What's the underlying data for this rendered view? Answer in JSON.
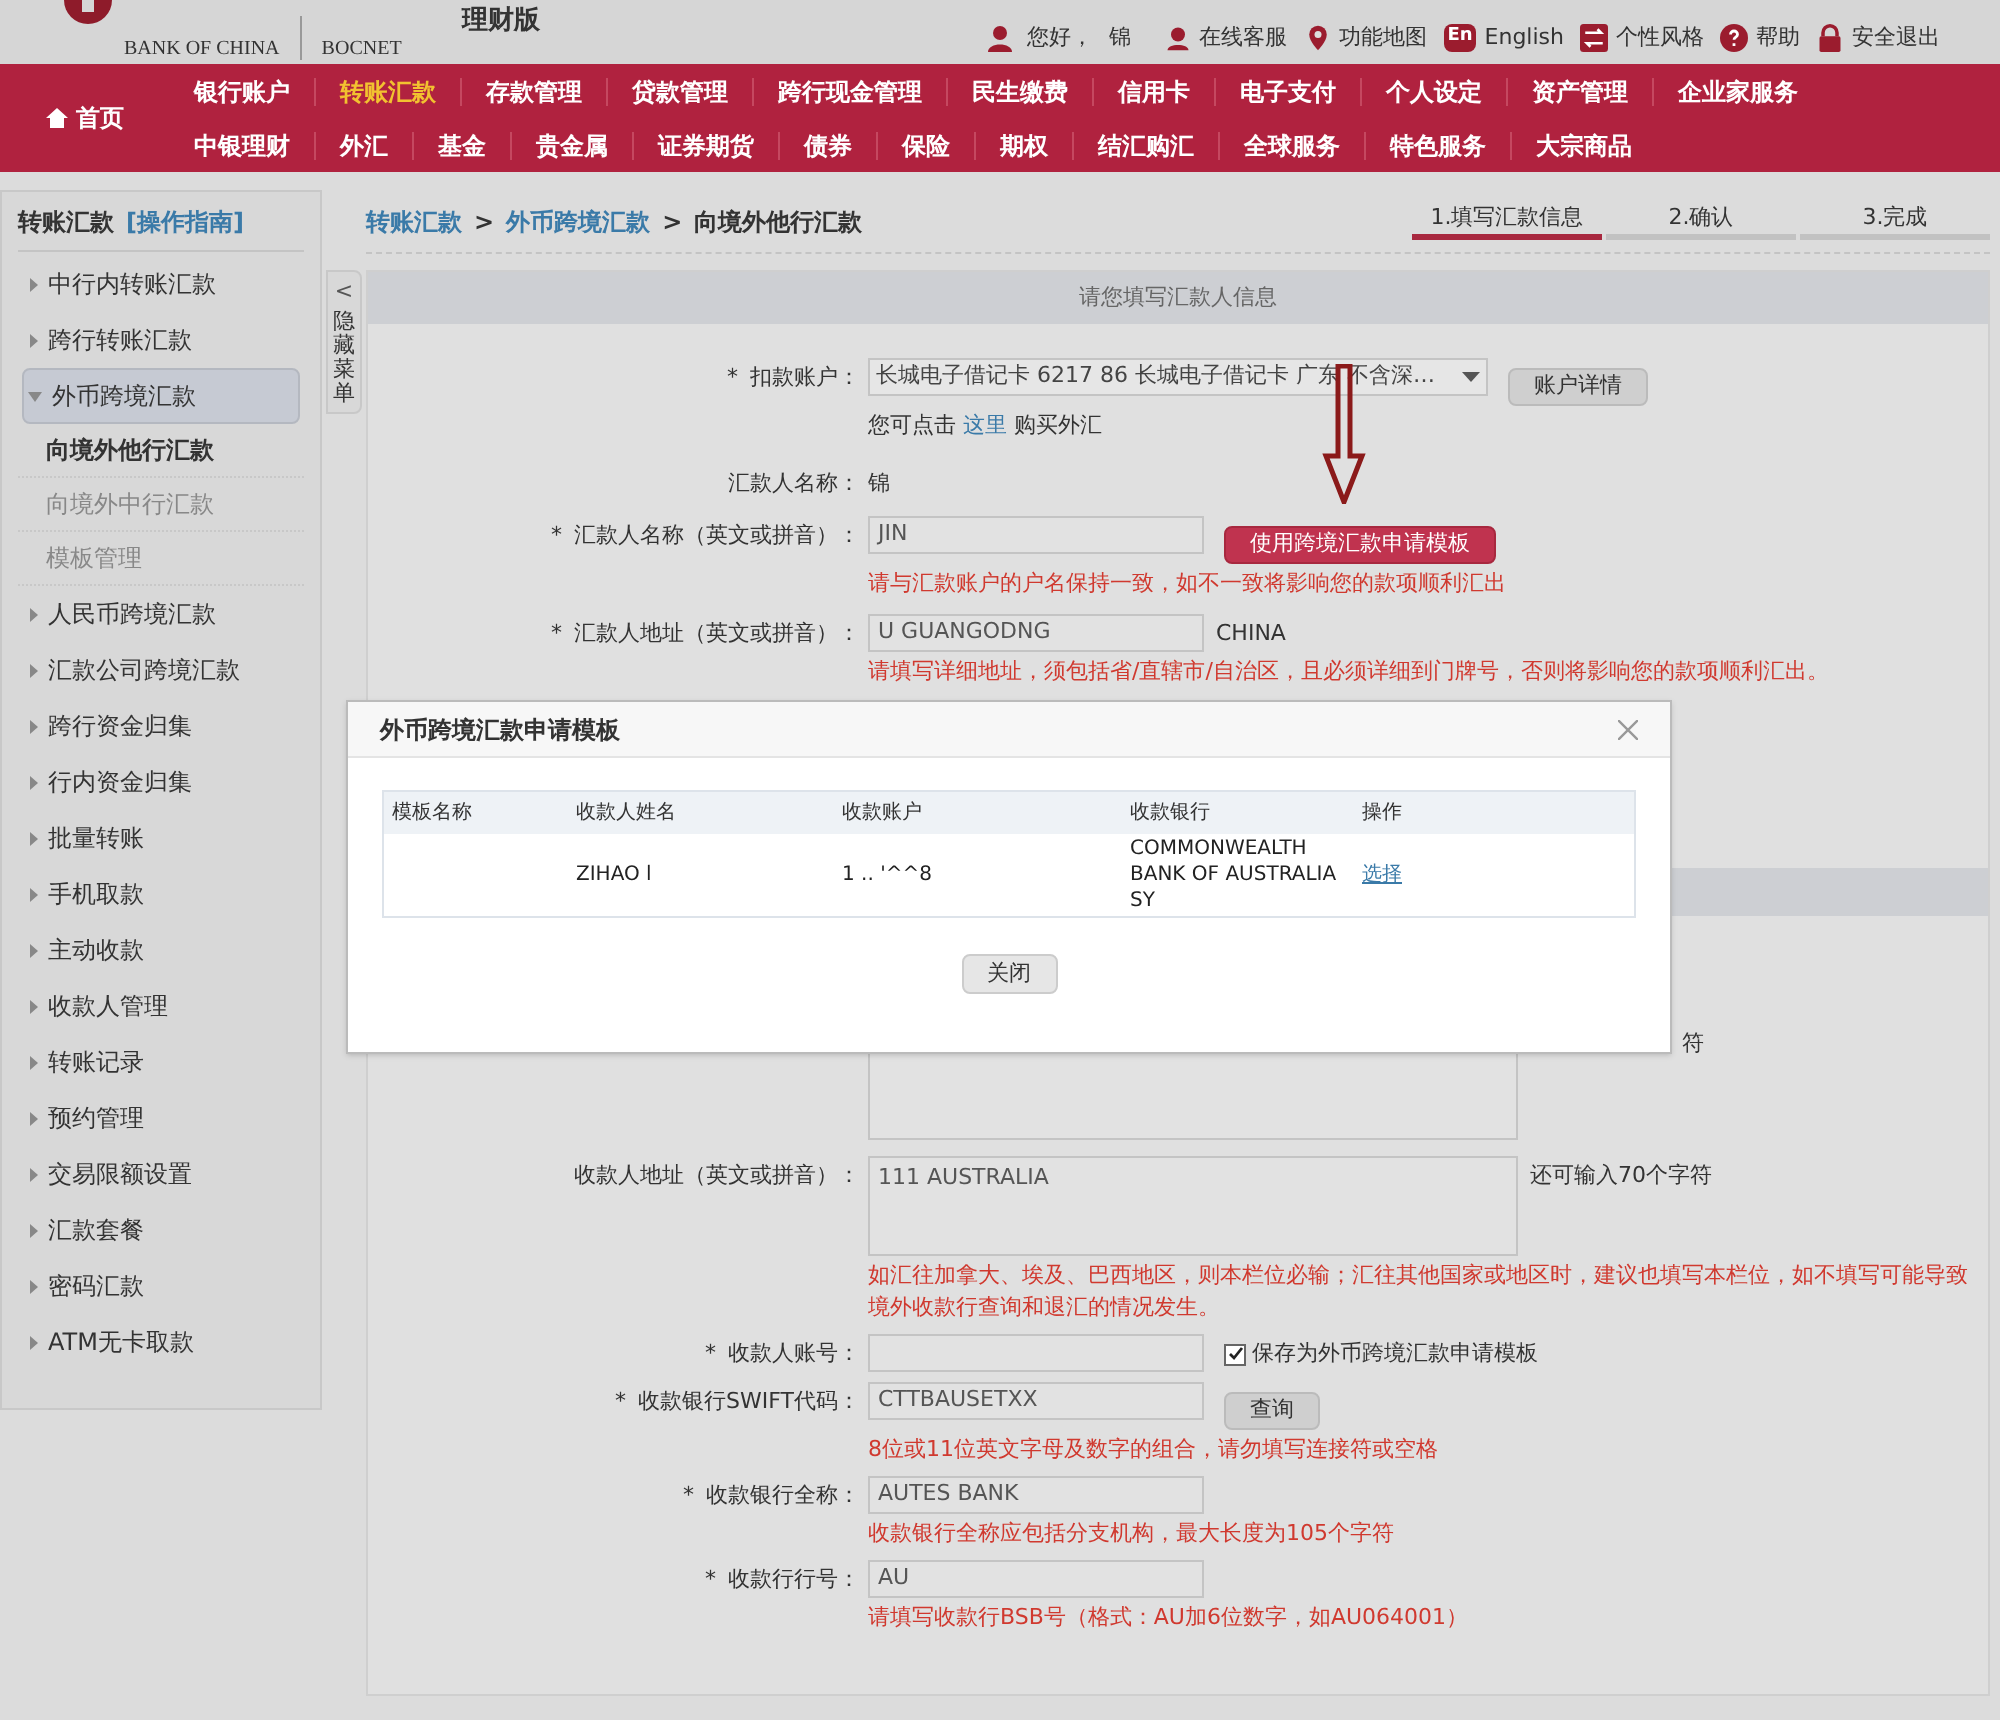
{
  "header": {
    "logo_text": "BANK OF CHINA",
    "brand": "BOCNET",
    "edition": "理财版",
    "greeting": "您好，",
    "user": "锦",
    "links": [
      {
        "kind": "service",
        "label": "在线客服"
      },
      {
        "kind": "map",
        "label": "功能地图"
      },
      {
        "kind": "language",
        "badge": "En",
        "label": "English"
      },
      {
        "kind": "style",
        "label": "个性风格"
      },
      {
        "kind": "help",
        "label": "帮助"
      },
      {
        "kind": "logout",
        "label": "安全退出"
      }
    ]
  },
  "nav": {
    "home": "首页",
    "primary": [
      {
        "label": "银行账户",
        "selected": false
      },
      {
        "label": "转账汇款",
        "selected": true
      },
      {
        "label": "存款管理",
        "selected": false
      },
      {
        "label": "贷款管理",
        "selected": false
      },
      {
        "label": "跨行现金管理",
        "selected": false
      },
      {
        "label": "民生缴费",
        "selected": false
      },
      {
        "label": "信用卡",
        "selected": false
      },
      {
        "label": "电子支付",
        "selected": false
      },
      {
        "label": "个人设定",
        "selected": false
      },
      {
        "label": "资产管理",
        "selected": false
      },
      {
        "label": "企业家服务",
        "selected": false
      }
    ],
    "secondary": [
      {
        "label": "中银理财",
        "selected": false
      },
      {
        "label": "外汇",
        "selected": false
      },
      {
        "label": "基金",
        "selected": false
      },
      {
        "label": "贵金属",
        "selected": false
      },
      {
        "label": "证券期货",
        "selected": false
      },
      {
        "label": "债券",
        "selected": false
      },
      {
        "label": "保险",
        "selected": false
      },
      {
        "label": "期权",
        "selected": false
      },
      {
        "label": "结汇购汇",
        "selected": false
      },
      {
        "label": "全球服务",
        "selected": false
      },
      {
        "label": "特色服务",
        "selected": false
      },
      {
        "label": "大宗商品",
        "selected": false
      }
    ]
  },
  "sidebar": {
    "title": "转账汇款",
    "guide": "[操作指南]",
    "collapse_arrow": "<",
    "collapse_label": "隐藏菜单",
    "items": [
      {
        "label": "中行内转账汇款",
        "expanded": false
      },
      {
        "label": "跨行转账汇款",
        "expanded": false
      },
      {
        "label": "外币跨境汇款",
        "expanded": true,
        "children": [
          {
            "label": "向境外他行汇款",
            "selected": true
          },
          {
            "label": "向境外中行汇款",
            "selected": false
          },
          {
            "label": "模板管理",
            "selected": false
          }
        ]
      },
      {
        "label": "人民币跨境汇款",
        "expanded": false
      },
      {
        "label": "汇款公司跨境汇款",
        "expanded": false
      },
      {
        "label": "跨行资金归集",
        "expanded": false
      },
      {
        "label": "行内资金归集",
        "expanded": false
      },
      {
        "label": "批量转账",
        "expanded": false
      },
      {
        "label": "手机取款",
        "expanded": false
      },
      {
        "label": "主动收款",
        "expanded": false
      },
      {
        "label": "收款人管理",
        "expanded": false
      },
      {
        "label": "转账记录",
        "expanded": false
      },
      {
        "label": "预约管理",
        "expanded": false
      },
      {
        "label": "交易限额设置",
        "expanded": false
      },
      {
        "label": "汇款套餐",
        "expanded": false
      },
      {
        "label": "密码汇款",
        "expanded": false
      },
      {
        "label": "ATM无卡取款",
        "expanded": false
      }
    ]
  },
  "breadcrumb": {
    "separator": ">",
    "items": [
      {
        "label": "转账汇款",
        "kind": "link"
      },
      {
        "label": "外币跨境汇款",
        "kind": "link"
      },
      {
        "label": "向境外他行汇款",
        "kind": "current"
      }
    ]
  },
  "steps": [
    {
      "label": "1.填写汇款信息",
      "selected": true
    },
    {
      "label": "2.确认",
      "selected": false
    },
    {
      "label": "3.完成",
      "selected": false
    }
  ],
  "section_title": "请您填写汇款人信息",
  "top_rows": [
    {
      "kind": "select",
      "required_mark": "*",
      "label": "扣款账户：",
      "value": "长城电子借记卡 6217 86 长城电子借记卡 广东 不含深…",
      "button": {
        "label": "账户详情",
        "kind": "plain"
      }
    },
    {
      "kind": "note",
      "before": "您可点击",
      "link": "这里",
      "after": "购买外汇"
    },
    {
      "kind": "static",
      "label": "汇款人名称：",
      "value": "锦"
    },
    {
      "kind": "input",
      "required_mark": "*",
      "label": "汇款人名称（英文或拼音）：",
      "value": "JIN",
      "button": {
        "label": "使用跨境汇款申请模板",
        "kind": "primary"
      },
      "hint": "请与汇款账户的户名保持一致，如不一致将影响您的款项顺利汇出"
    },
    {
      "kind": "input",
      "required_mark": "*",
      "label": "汇款人地址（英文或拼音）：",
      "value": "U GUANGODNG",
      "suffix": "CHINA",
      "hint": "请填写详细地址，须包括省/直辖市/自治区，且必须详细到门牌号，否则将影响您的款项顺利汇出。"
    }
  ],
  "bottom_rows": [
    {
      "kind": "textarea",
      "suffix": "符"
    },
    {
      "kind": "textarea",
      "label": "收款人地址（英文或拼音）：",
      "value": "111 AUSTRALIA",
      "suffix": "还可输入70个字符",
      "hint": "如汇往加拿大、埃及、巴西地区，则本栏位必输；汇往其他国家或地区时，建议也填写本栏位，如不填写可能导致境外收款行查询和退汇的情况发生。"
    },
    {
      "kind": "input",
      "required_mark": "*",
      "label": "收款人账号：",
      "checkbox": {
        "label": "保存为外币跨境汇款申请模板",
        "checked": true
      }
    },
    {
      "kind": "input",
      "required_mark": "*",
      "label": "收款银行SWIFT代码：",
      "value": "CTTBAUSETXX",
      "button": {
        "label": "查询",
        "kind": "plain"
      },
      "hint": "8位或11位英文字母及数字的组合，请勿填写连接符或空格"
    },
    {
      "kind": "input",
      "required_mark": "*",
      "label": "收款银行全称：",
      "value": "AUTES BANK",
      "hint": "收款银行全称应包括分支机构，最大长度为105个字符"
    },
    {
      "kind": "input",
      "required_mark": "*",
      "label": "收款行行号：",
      "value": "AU",
      "hint": "请填写收款行BSB号（格式：AU加6位数字，如AU064001）"
    }
  ],
  "modal": {
    "title": "外币跨境汇款申请模板",
    "columns": [
      "模板名称",
      "收款人姓名",
      "收款账户",
      "收款银行",
      "操作"
    ],
    "rows": [
      {
        "payee": "ZIHAO l",
        "account": "1 ..  '^^8",
        "bank": "COMMONWEALTH BANK OF AUSTRALIA SY",
        "action": "选择"
      }
    ],
    "button": "关闭"
  }
}
